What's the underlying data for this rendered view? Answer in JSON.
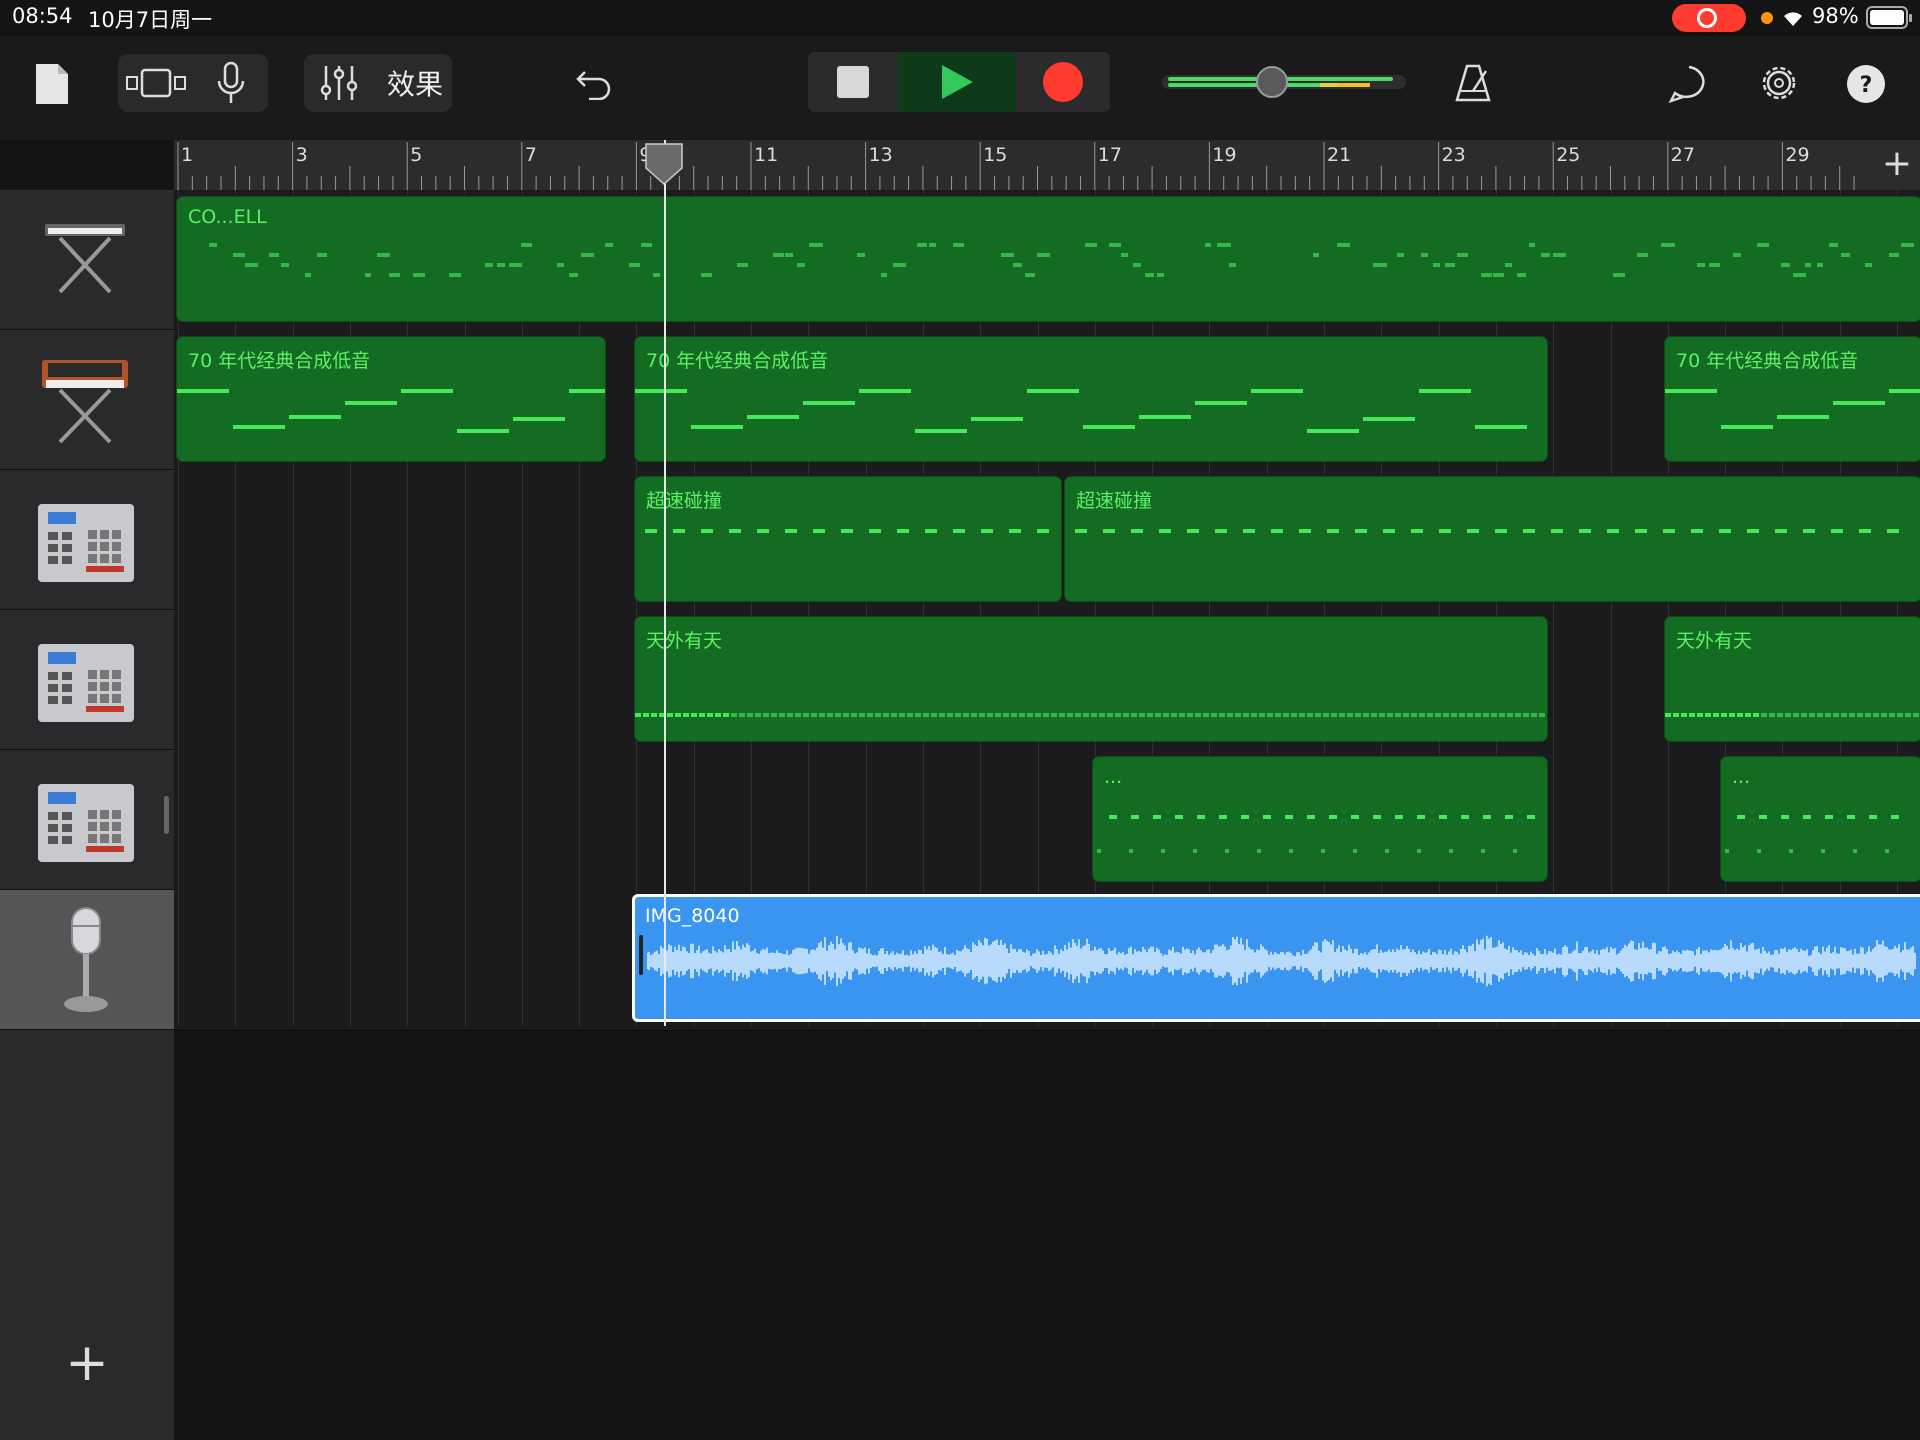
{
  "status_bar": {
    "time": "08:54",
    "date": "10月7日周一",
    "battery_percent": "98%"
  },
  "toolbar": {
    "fx_label": "效果"
  },
  "ruler": {
    "bars": [
      "1",
      "3",
      "5",
      "7",
      "9",
      "11",
      "13",
      "15",
      "17",
      "19",
      "21",
      "23",
      "25",
      "27",
      "29"
    ]
  },
  "regions": {
    "keys_1": "CO...ELL",
    "bass_1": "70 年代经典合成低音",
    "bass_2": "70 年代经典合成低音",
    "bass_3": "70 年代经典合成低音",
    "drums_a_1": "超速碰撞",
    "drums_a_2": "超速碰撞",
    "drums_b_1": "天外有天",
    "drums_b_2": "天外有天",
    "drums_c_1": "...",
    "drums_c_2": "...",
    "audio_1": "IMG_8040"
  },
  "tracks": [
    {
      "icon": "keyboard-icon"
    },
    {
      "icon": "synthesizer-icon"
    },
    {
      "icon": "drum-machine-icon"
    },
    {
      "icon": "drum-machine-icon"
    },
    {
      "icon": "drum-machine-icon"
    },
    {
      "icon": "microphone-icon"
    }
  ],
  "colors": {
    "midi_region": "#146b22",
    "midi_note": "#45e858",
    "audio_region": "#3a95f0",
    "record": "#ff3b30",
    "play": "#34c759"
  }
}
